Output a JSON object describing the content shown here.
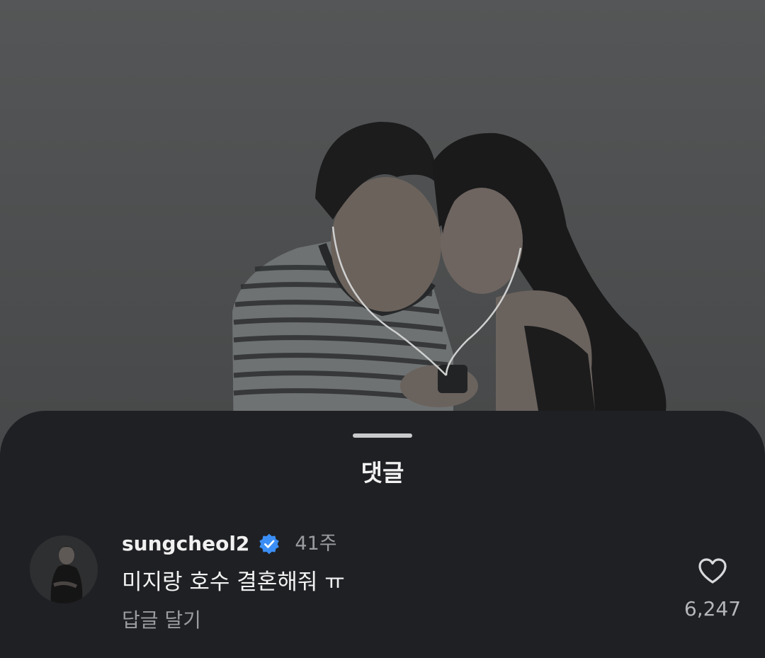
{
  "sheet": {
    "title": "댓글"
  },
  "comment": {
    "username": "sungcheol2",
    "verified": true,
    "time": "41주",
    "text": "미지랑 호수 결혼해줘 ㅠ",
    "reply_label": "답글 달기",
    "like_count": "6,247"
  },
  "icons": {
    "verified": "verified-badge-icon",
    "like": "heart-outline-icon",
    "handle": "drag-handle"
  },
  "colors": {
    "sheet_bg": "#1f2024",
    "photo_bg": "#4a4c4d",
    "verified_blue": "#3b8ef5",
    "secondary_text": "#9a9ca0"
  }
}
